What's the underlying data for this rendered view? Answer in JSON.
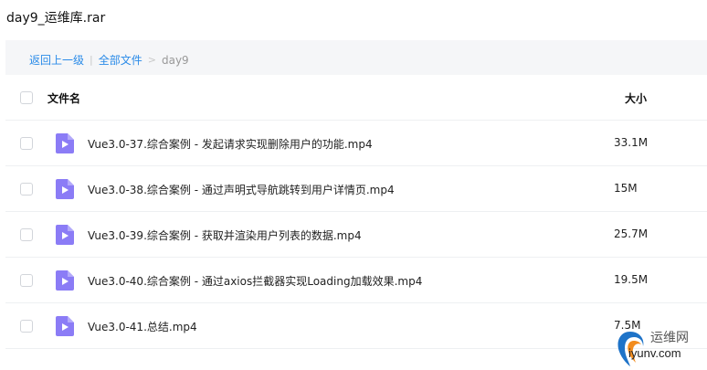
{
  "window": {
    "title": "day9_运维库.rar"
  },
  "breadcrumb": {
    "back_label": "返回上一级",
    "separator": "|",
    "all_files_label": "全部文件",
    "arrow": ">",
    "current": "day9"
  },
  "table": {
    "headers": {
      "name": "文件名",
      "size": "大小"
    },
    "rows": [
      {
        "name": "Vue3.0-37.综合案例 - 发起请求实现删除用户的功能.mp4",
        "size": "33.1M"
      },
      {
        "name": "Vue3.0-38.综合案例 - 通过声明式导航跳转到用户详情页.mp4",
        "size": "15M"
      },
      {
        "name": "Vue3.0-39.综合案例 - 获取并渲染用户列表的数据.mp4",
        "size": "25.7M"
      },
      {
        "name": "Vue3.0-40.综合案例 - 通过axios拦截器实现Loading加载效果.mp4",
        "size": "19.5M"
      },
      {
        "name": "Vue3.0-41.总结.mp4",
        "size": "7.5M"
      }
    ]
  },
  "icons": {
    "file": "video-file-icon",
    "file_color": "#8b7cf6"
  },
  "watermark": {
    "name": "运维网",
    "url": "iyunv.com"
  }
}
